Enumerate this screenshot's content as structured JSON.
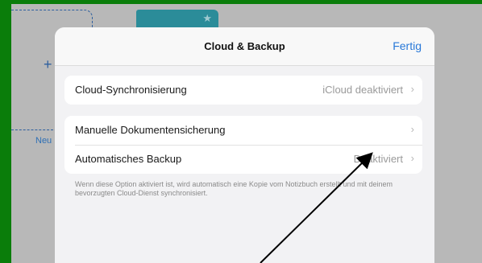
{
  "background": {
    "new_label": "Neu",
    "plus_icon": "plus-icon",
    "star_icon": "star-icon"
  },
  "modal": {
    "title": "Cloud & Backup",
    "done_label": "Fertig",
    "sync_group": {
      "label": "Cloud-Synchronisierung",
      "value": "iCloud deaktiviert"
    },
    "backup_group": {
      "manual_label": "Manuelle Dokumentensicherung",
      "auto_label": "Automatisches Backup",
      "auto_value": "Deaktiviert"
    },
    "footnote": "Wenn diese Option aktiviert ist, wird automatisch eine Kopie vom Notizbuch erstellt und mit deinem bevorzugten Cloud-Dienst synchronisiert."
  },
  "colors": {
    "frame": "#0a7d0a",
    "accent": "#2878d8",
    "notebook": "#2b8c99"
  }
}
